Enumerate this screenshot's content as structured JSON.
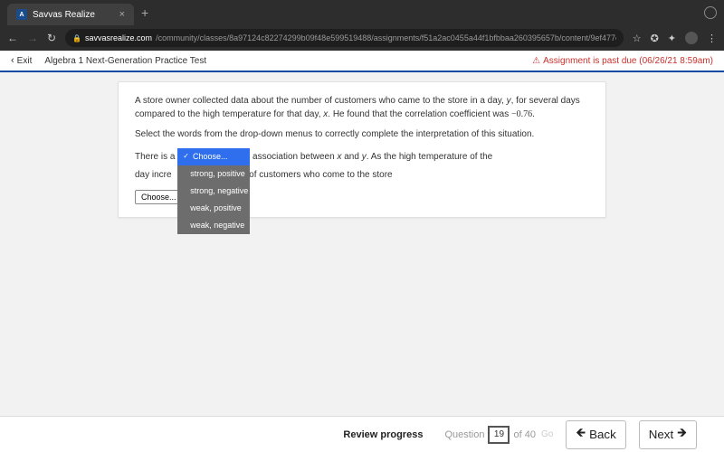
{
  "browser": {
    "tab_title": "Savvas Realize",
    "favicon_letter": "A",
    "url_host": "savvasrealize.com",
    "url_path": "/community/classes/8a97124c82274299b09f48e599519488/assignments/f51a2ac0455a44f1bfbbaa260395657b/content/9ef477e2-fc2e-3a98-81c..."
  },
  "subheader": {
    "exit": "Exit",
    "assignment": "Algebra 1 Next-Generation Practice Test",
    "warning": "Assignment is past due (06/26/21 8:59am)"
  },
  "question": {
    "p1_a": "A store owner collected data about the number of customers who came to the store in a day, ",
    "p1_y": "y",
    "p1_b": ", for several days compared to the high temperature for that day, ",
    "p1_x": "x",
    "p1_c": ". He found that the correlation coefficient was ",
    "coeff": "−0.76",
    "p1_d": ".",
    "p2": "Select the words from the drop-down menus to correctly complete the interpretation of this situation.",
    "s1_a": "There is a ",
    "s1_b": " association between ",
    "s1_x": "x",
    "s1_c": " and ",
    "s1_y": "y",
    "s1_d": ". As the high temperature of the",
    "s2_a": "day increases, the number of customers who come to the store",
    "choose_label": "Choose...",
    "dropdown": {
      "selected": "Choose...",
      "options": [
        "strong, positive",
        "strong, negative",
        "weak, positive",
        "weak, negative"
      ]
    }
  },
  "footer": {
    "review": "Review progress",
    "question_label": "Question",
    "current": "19",
    "of": "of 40",
    "go": "Go",
    "back": "Back",
    "next": "Next"
  }
}
